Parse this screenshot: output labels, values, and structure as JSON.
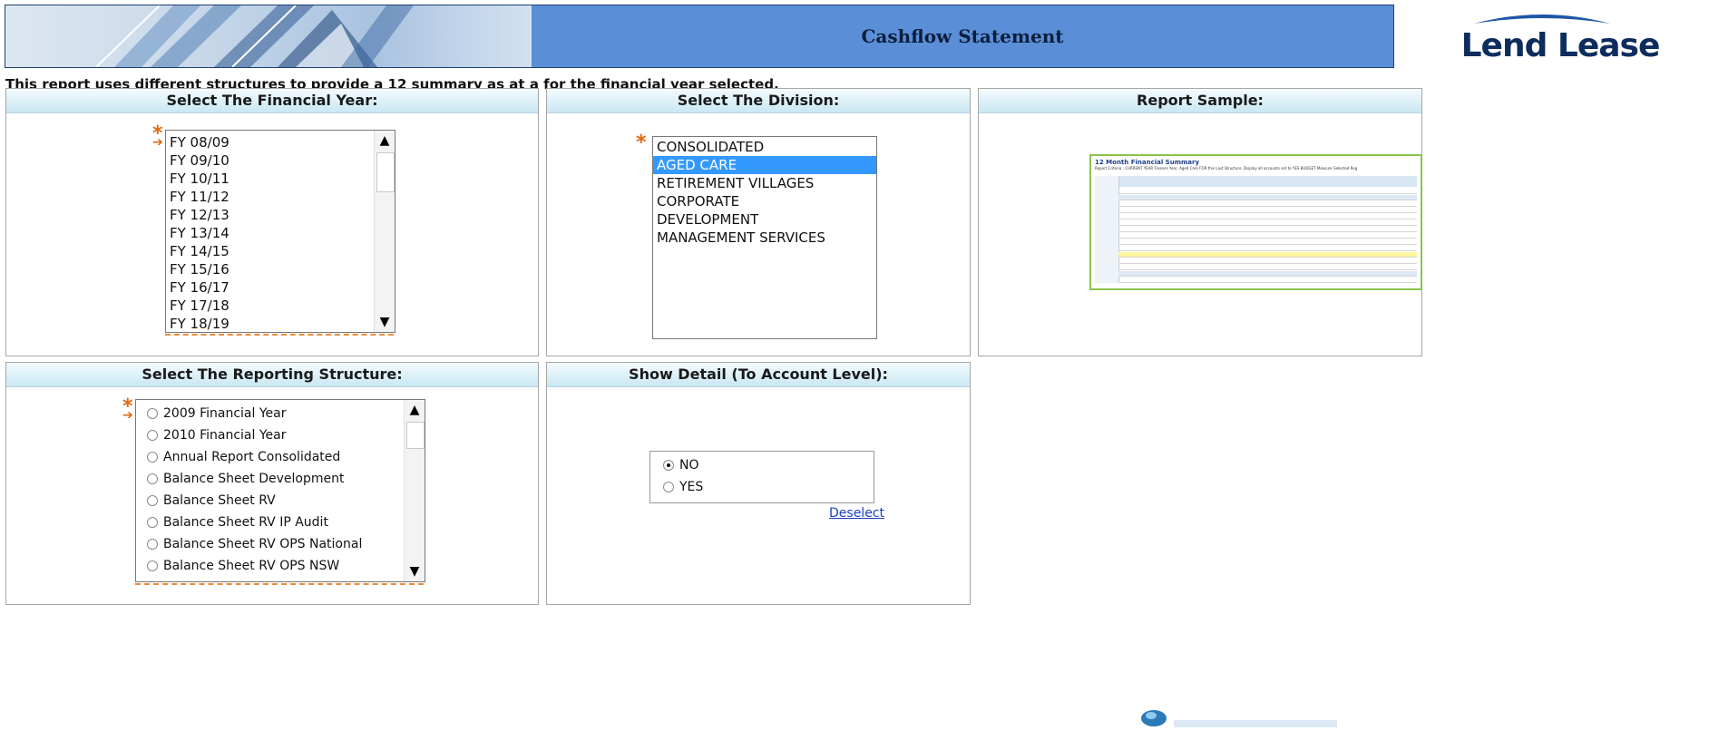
{
  "header": {
    "title": "Cashflow Statement",
    "logo_text": "Lend Lease"
  },
  "intro_text": "This report uses different structures to provide a 12 summary as at a for the financial year selected.",
  "financial_year": {
    "heading": "Select The Financial Year:",
    "required_marker": "*",
    "items": [
      "FY 08/09",
      "FY 09/10",
      "FY 10/11",
      "FY 11/12",
      "FY 12/13",
      "FY 13/14",
      "FY 14/15",
      "FY 15/16",
      "FY 16/17",
      "FY 17/18",
      "FY 18/19"
    ],
    "selected_index": -1
  },
  "division": {
    "heading": "Select The Division:",
    "required_marker": "*",
    "items": [
      "CONSOLIDATED",
      "AGED CARE",
      "RETIREMENT VILLAGES",
      "CORPORATE",
      "DEVELOPMENT",
      "MANAGEMENT SERVICES"
    ],
    "selected_index": 1
  },
  "sample": {
    "heading": "Report Sample:",
    "thumb_title": "12 Month Financial Summary",
    "thumb_subtitle": "Report Criteria : CURRENT YEAR Finance Year, Aged Care FOR this Last Structure. Display all accounts set to YES BUDGET Measure Selected Reg"
  },
  "reporting_structure": {
    "heading": "Select The Reporting Structure:",
    "required_marker": "*",
    "items": [
      "2009 Financial Year",
      "2010 Financial Year",
      "Annual Report Consolidated",
      "Balance Sheet Development",
      "Balance Sheet RV",
      "Balance Sheet RV IP Audit",
      "Balance Sheet RV OPS National",
      "Balance Sheet RV OPS NSW"
    ]
  },
  "show_detail": {
    "heading": "Show Detail (To Account Level):",
    "options": [
      "NO",
      "YES"
    ],
    "selected": "NO",
    "deselect_label": "Deselect"
  },
  "colors": {
    "banner_blue": "#5a8fd8",
    "selection_blue": "#3399ff",
    "required_orange": "#e4670d",
    "logo_navy": "#0d2c5e"
  }
}
